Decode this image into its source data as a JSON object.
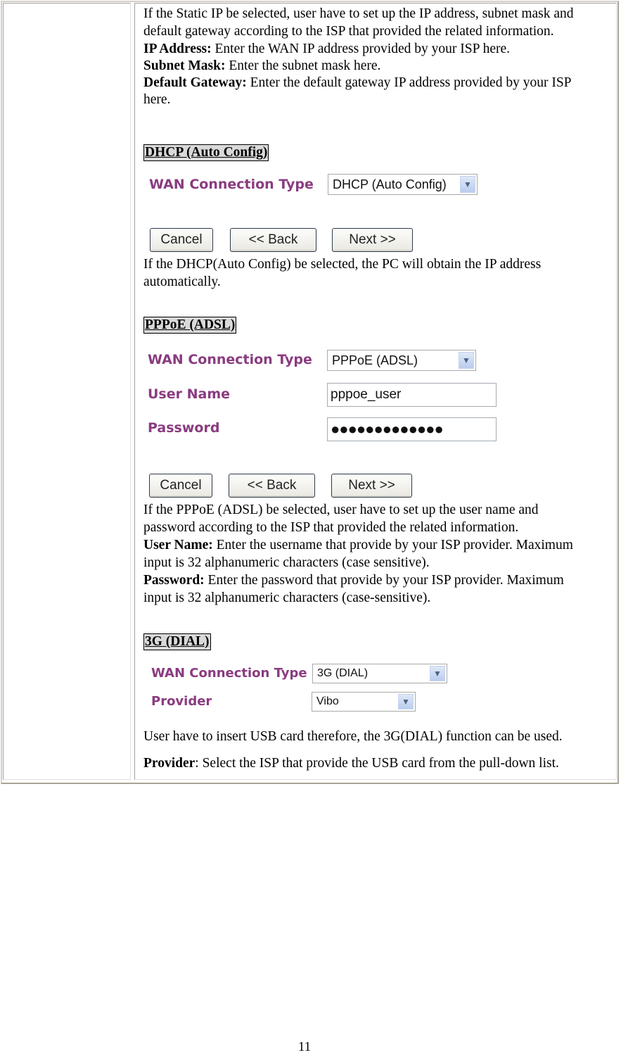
{
  "static_ip": {
    "intro_line1": "If the Static IP be selected, user have to set up the IP address, subnet mask and",
    "intro_line2": "default gateway according to the ISP that provided the related information.",
    "ip_label": "IP Address:",
    "ip_text": " Enter the WAN IP address provided by your ISP here.",
    "mask_label": "Subnet Mask:",
    "mask_text": " Enter the subnet mask here.",
    "gw_label": "Default Gateway:",
    "gw_text": " Enter the default gateway IP address provided by your ISP",
    "gw_text2": "here."
  },
  "dhcp": {
    "heading": "DHCP (Auto Config)",
    "wan_label": "WAN Connection Type",
    "wan_value": "DHCP (Auto Config)",
    "buttons": {
      "cancel": "Cancel",
      "back": "<<  Back",
      "next": "Next  >>"
    },
    "desc_line1": "If the DHCP(Auto Config) be selected, the PC will obtain the IP address",
    "desc_line2": "automatically."
  },
  "pppoe": {
    "heading": "PPPoE (ADSL)",
    "wan_label": "WAN Connection Type",
    "wan_value": "PPPoE (ADSL)",
    "user_label": "User Name",
    "user_value": "pppoe_user",
    "pass_label": "Password",
    "pass_value": "●●●●●●●●●●●●●",
    "buttons": {
      "cancel": "Cancel",
      "back": "<<  Back",
      "next": "Next  >>"
    },
    "desc_line1": "If the PPPoE (ADSL) be selected, user have to set up the user name and",
    "desc_line2": "password according to the ISP that provided the related information.",
    "un_label": "User Name:",
    "un_text": " Enter the username that provide by your ISP provider. Maximum",
    "un_text2": "input is 32 alphanumeric characters (case sensitive).",
    "pw_label": "Password:",
    "pw_text": " Enter the password that provide by your ISP provider. Maximum",
    "pw_text2": "input is 32 alphanumeric characters (case-sensitive)."
  },
  "g3": {
    "heading": "3G (DIAL)",
    "wan_label": "WAN Connection Type",
    "wan_value": "3G (DIAL)",
    "provider_label": "Provider",
    "provider_value": "Vibo",
    "desc": "User have to insert USB card therefore, the 3G(DIAL) function can be used.",
    "prov_label": "Provider",
    "prov_text": ": Select the ISP that provide the USB card from the pull-down list."
  },
  "page_number": "11"
}
